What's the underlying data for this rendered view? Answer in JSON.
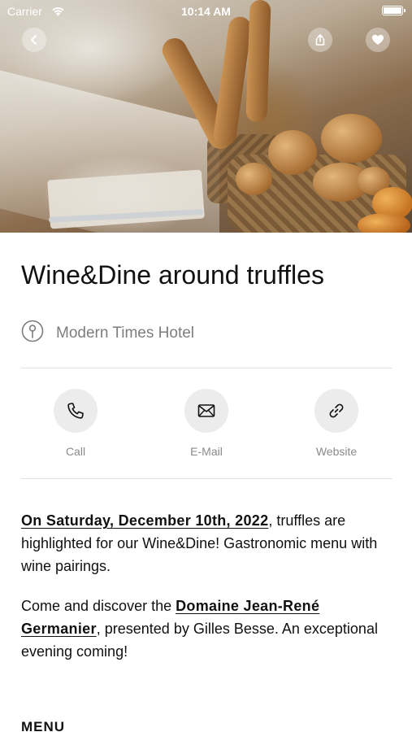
{
  "status_bar": {
    "carrier": "Carrier",
    "time": "10:14 AM"
  },
  "hero": {
    "image": "bakery-bread-baskets-photo"
  },
  "nav": {
    "back_icon": "chevron-left-icon",
    "share_icon": "share-icon",
    "favorite_icon": "heart-icon"
  },
  "event": {
    "title": "Wine&Dine around truffles",
    "venue": "Modern Times Hotel",
    "venue_icon": "location-pin-icon"
  },
  "actions": [
    {
      "label": "Call",
      "icon": "phone-icon"
    },
    {
      "label": "E-Mail",
      "icon": "mail-icon"
    },
    {
      "label": "Website",
      "icon": "link-icon"
    }
  ],
  "description": {
    "p1_link": "On Saturday, December 10th, 2022",
    "p1_text": ", truffles are highlighted for our Wine&Dine! Gastronomic menu with wine pairings.",
    "p2_prefix": "Come and discover the ",
    "p2_link": "Domaine Jean-René Germanier",
    "p2_text": ", presented by Gilles Besse. An exceptional evening coming!"
  },
  "menu": {
    "heading": "MENU"
  },
  "colors": {
    "text": "#111111",
    "muted": "#7d7d7d",
    "icon_bg": "#ececec",
    "divider": "#e3e3e3"
  }
}
